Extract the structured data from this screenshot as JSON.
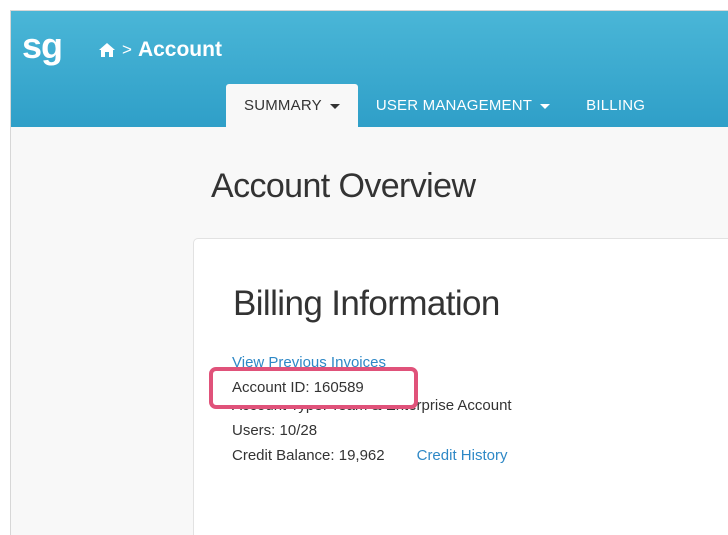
{
  "header": {
    "logo": "sg",
    "breadcrumb_separator": ">",
    "breadcrumb_title": "Account"
  },
  "tabs": [
    {
      "label": "SUMMARY",
      "has_caret": true,
      "active": true
    },
    {
      "label": "USER MANAGEMENT",
      "has_caret": true,
      "active": false
    },
    {
      "label": "BILLING",
      "has_caret": false,
      "active": false
    }
  ],
  "page": {
    "title": "Account Overview"
  },
  "billing": {
    "heading": "Billing Information",
    "invoices_link": "View Previous Invoices",
    "account_id": "Account ID: 160589",
    "account_type": "Account Type: Team & Enterprise Account",
    "users": "Users: 10/28",
    "credit_balance": "Credit Balance: 19,962",
    "credit_history_link": "Credit History"
  },
  "colors": {
    "header_top": "#4ab6d7",
    "header_bottom": "#2f9fc8",
    "link": "#2e88c6",
    "highlight": "#e0527a"
  },
  "icons": {
    "home": "home-icon",
    "caret": "caret-down-icon"
  }
}
